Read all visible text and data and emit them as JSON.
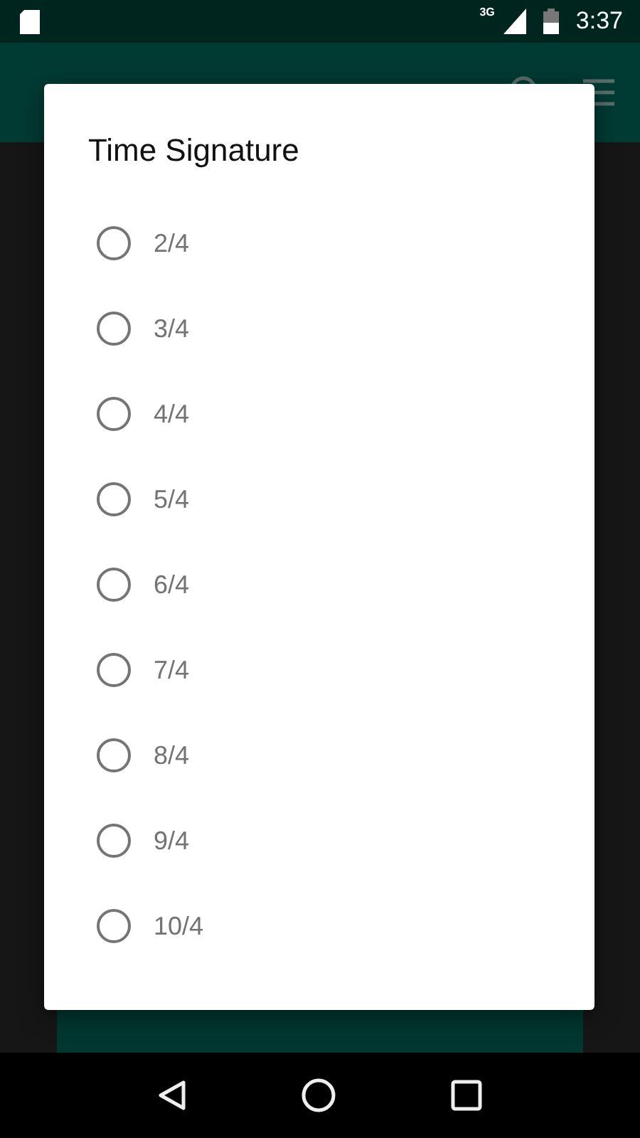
{
  "status_bar": {
    "network": "3G",
    "time": "3:37"
  },
  "dialog": {
    "title": "Time Signature",
    "options": [
      {
        "label": "2/4",
        "selected": false
      },
      {
        "label": "3/4",
        "selected": false
      },
      {
        "label": "4/4",
        "selected": false
      },
      {
        "label": "5/4",
        "selected": false
      },
      {
        "label": "6/4",
        "selected": false
      },
      {
        "label": "7/4",
        "selected": false
      },
      {
        "label": "8/4",
        "selected": false
      },
      {
        "label": "9/4",
        "selected": false
      },
      {
        "label": "10/4",
        "selected": false
      }
    ]
  }
}
